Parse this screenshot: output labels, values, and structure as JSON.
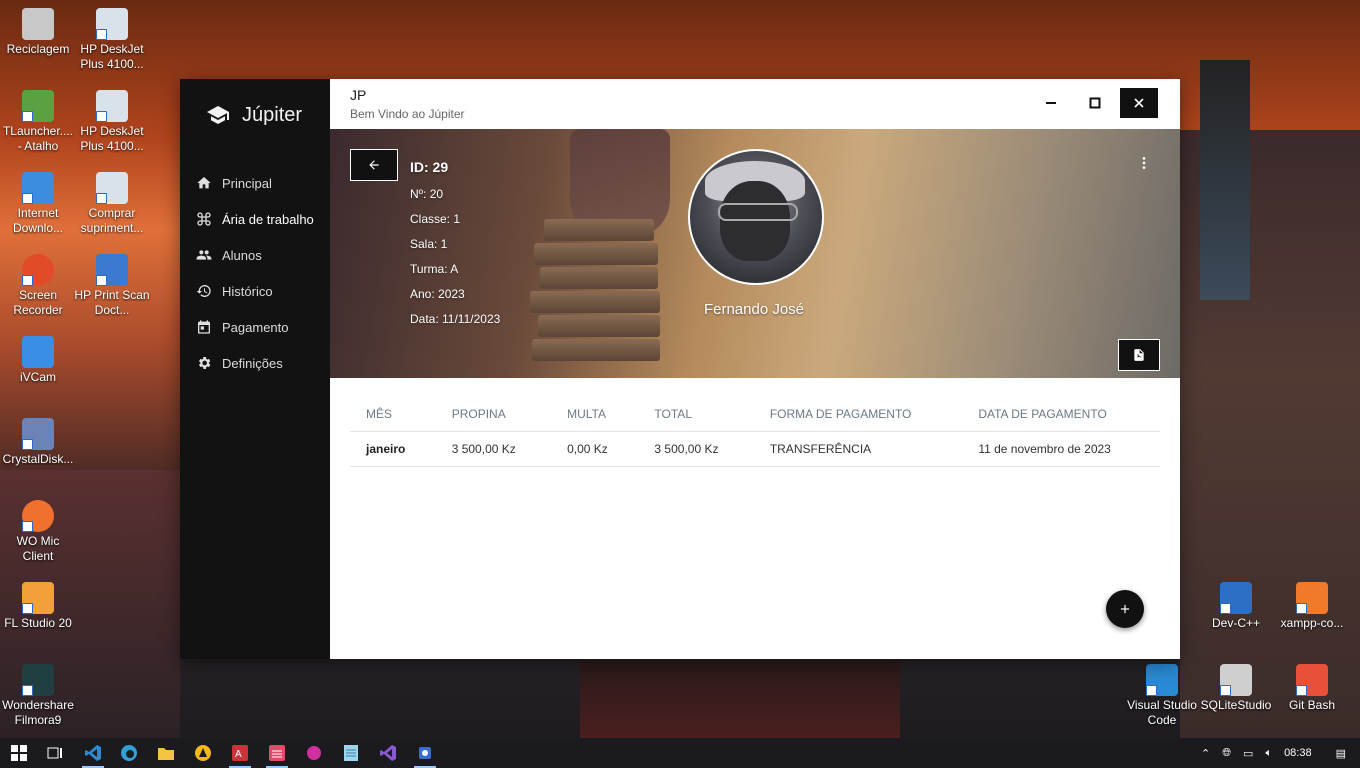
{
  "desktop": {
    "icons_left": [
      {
        "label": "Reciclagem",
        "icon": "recycle-bin-icon",
        "color": "#c8c8c8"
      },
      {
        "label": "TLauncher.... - Atalho",
        "icon": "tlauncher-icon",
        "color": "#5aa142"
      },
      {
        "label": "Internet Downlo...",
        "icon": "internet-download-manager-icon",
        "color": "#3c8de0"
      },
      {
        "label": "Screen Recorder",
        "icon": "screen-recorder-icon",
        "color": "#e24a2a"
      },
      {
        "label": "iVCam",
        "icon": "ivcam-icon",
        "color": "#3a8ee6"
      },
      {
        "label": "CrystalDisk...",
        "icon": "crystaldisk-icon",
        "color": "#6c83b7"
      },
      {
        "label": "WO Mic Client",
        "icon": "wo-mic-icon",
        "color": "#f07030"
      },
      {
        "label": "FL Studio 20",
        "icon": "fl-studio-icon",
        "color": "#f2a13a"
      },
      {
        "label": "Wondershare Filmora9",
        "icon": "filmora-icon",
        "color": "#1f3f40"
      }
    ],
    "icons_col2": [
      {
        "label": "HP DeskJet Plus 4100...",
        "icon": "printer-icon",
        "color": "#d8e2ea"
      },
      {
        "label": "HP DeskJet Plus 4100...",
        "icon": "printer-icon",
        "color": "#d8e2ea"
      },
      {
        "label": "Comprar supriment...",
        "icon": "printer-supplies-icon",
        "color": "#d8e2ea"
      },
      {
        "label": "HP Print Scan Doct...",
        "icon": "print-scan-doctor-icon",
        "color": "#3a7ad0"
      }
    ],
    "icons_right": [
      {
        "label": "Dev-C++",
        "icon": "dev-cpp-icon",
        "color": "#2c6fc4"
      },
      {
        "label": "xampp-co...",
        "icon": "xampp-icon",
        "color": "#f07a2a"
      },
      {
        "label": "Visual Studio Code",
        "icon": "vscode-icon",
        "color": "#2a8ad4"
      },
      {
        "label": "SQLiteStudio",
        "icon": "sqlitestudio-icon",
        "color": "#cfcfcf"
      },
      {
        "label": "Git Bash",
        "icon": "git-bash-icon",
        "color": "#e8503a"
      }
    ]
  },
  "app": {
    "brand": "Júpiter",
    "window_title": "JP",
    "window_subtitle": "Bem Vindo ao  Júpiter",
    "nav": [
      {
        "label": "Principal",
        "icon": "home-icon"
      },
      {
        "label": "Ária de trabalho",
        "icon": "command-icon",
        "active": true
      },
      {
        "label": "Alunos",
        "icon": "people-icon"
      },
      {
        "label": "Histórico",
        "icon": "history-icon"
      },
      {
        "label": "Pagamento",
        "icon": "calendar-icon"
      },
      {
        "label": "Definições",
        "icon": "settings-icon"
      }
    ],
    "student": {
      "id": "ID: 29",
      "numero": "Nº: 20",
      "classe": "Classe: 1",
      "sala": "Sala: 1",
      "turma": "Turma: A",
      "ano": "Ano: 2023",
      "data": "Data: 11/11/2023",
      "name": "Fernando José"
    },
    "table": {
      "headers": [
        "MÊS",
        "PROPINA",
        "MULTA",
        "TOTAL",
        "FORMA DE PAGAMENTO",
        "DATA DE PAGAMENTO"
      ],
      "rows": [
        [
          "janeiro",
          "3 500,00 Kz",
          "0,00 Kz",
          "3 500,00 Kz",
          "TRANSFERÊNCIA",
          "11 de novembro de 2023"
        ]
      ]
    }
  },
  "taskbar": {
    "clock": "08:38",
    "apps": [
      "windows-start-icon",
      "task-view-icon",
      "vscode-icon",
      "edge-icon",
      "file-explorer-icon",
      "autocad-icon",
      "access-icon",
      "layers-icon",
      "gem-icon",
      "notepad-icon",
      "visual-studio-icon",
      "app-icon"
    ]
  },
  "colors": {
    "sidebar_bg": "#121212",
    "accent_dark": "#111111",
    "header_text": "#6b7a86"
  }
}
